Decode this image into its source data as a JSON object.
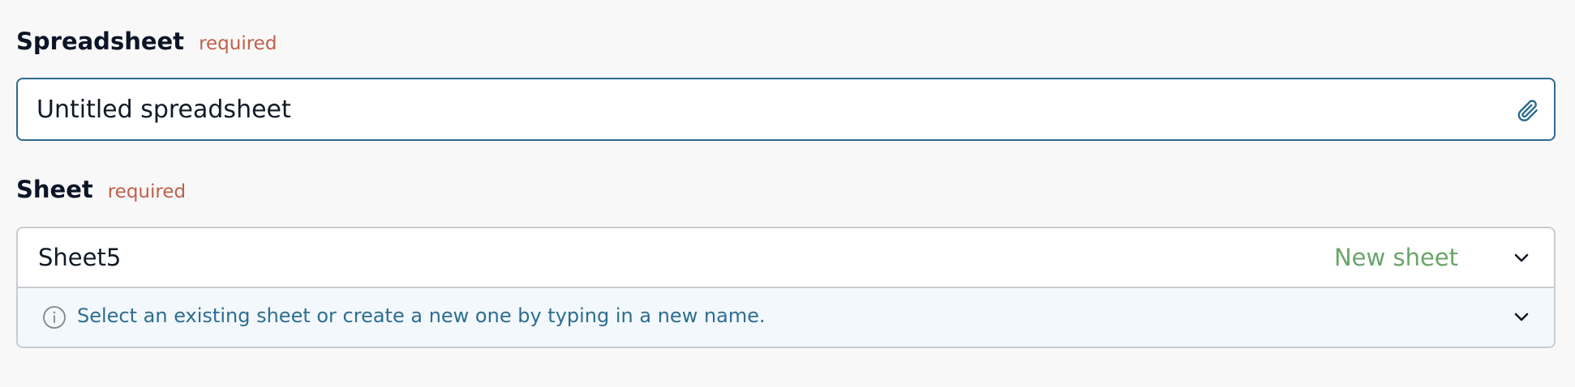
{
  "spreadsheet": {
    "label": "Spreadsheet",
    "required_text": "required",
    "value": "Untitled spreadsheet",
    "attach_icon": "paperclip-icon"
  },
  "sheet": {
    "label": "Sheet",
    "required_text": "required",
    "value": "Sheet5",
    "badge": "New sheet",
    "dropdown_icon": "chevron-down-icon",
    "info": {
      "icon": "info-icon",
      "text": "Select an existing sheet or create a new one by typing in a new name.",
      "expand_icon": "chevron-down-icon"
    }
  },
  "colors": {
    "required": "#c0604a",
    "input_border_focused": "#2d6a90",
    "new_sheet": "#6aa56a",
    "info_text": "#2e6e91",
    "info_bg": "#f2f8fb"
  }
}
